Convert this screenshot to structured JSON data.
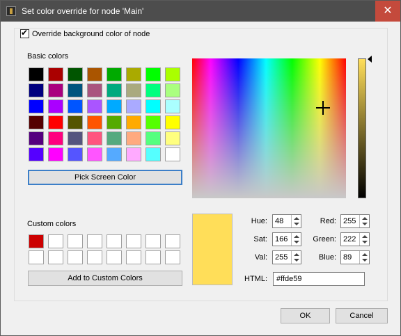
{
  "window": {
    "title": "Set color override for node 'Main'",
    "close_glyph": "✕"
  },
  "override": {
    "label": "Override background color of node",
    "checked": true,
    "check_glyph": "✔"
  },
  "basic_colors": {
    "label": "Basic colors",
    "swatches": [
      "#000000",
      "#aa0000",
      "#005500",
      "#aa5500",
      "#00aa00",
      "#aaaa00",
      "#00ff00",
      "#aaff00",
      "#00007f",
      "#aa007f",
      "#00557f",
      "#aa557f",
      "#00aa7f",
      "#aaaa7f",
      "#00ff7f",
      "#aaff7f",
      "#0000ff",
      "#aa00ff",
      "#0055ff",
      "#aa55ff",
      "#00aaff",
      "#aaaaff",
      "#00ffff",
      "#aaffff",
      "#550000",
      "#ff0000",
      "#555500",
      "#ff5500",
      "#55aa00",
      "#ffaa00",
      "#55ff00",
      "#ffff00",
      "#55007f",
      "#ff007f",
      "#55557f",
      "#ff557f",
      "#55aa7f",
      "#ffaa7f",
      "#55ff7f",
      "#ffff7f",
      "#5500ff",
      "#ff00ff",
      "#5555ff",
      "#ff55ff",
      "#55aaff",
      "#ffaaff",
      "#55ffff",
      "#ffffff"
    ]
  },
  "pick_screen_button": "Pick Screen Color",
  "custom_colors": {
    "label": "Custom colors",
    "swatches": [
      "#cc0000",
      "#ffffff",
      "#ffffff",
      "#ffffff",
      "#ffffff",
      "#ffffff",
      "#ffffff",
      "#ffffff",
      "#ffffff",
      "#ffffff",
      "#ffffff",
      "#ffffff",
      "#ffffff",
      "#ffffff",
      "#ffffff",
      "#ffffff"
    ]
  },
  "add_custom_button": "Add to Custom Colors",
  "current_color": "#ffde59",
  "fields": {
    "hue": {
      "label": "Hue:",
      "value": "48"
    },
    "sat": {
      "label": "Sat:",
      "value": "166"
    },
    "val": {
      "label": "Val:",
      "value": "255"
    },
    "red": {
      "label": "Red:",
      "value": "255"
    },
    "green": {
      "label": "Green:",
      "value": "222"
    },
    "blue": {
      "label": "Blue:",
      "value": "89"
    },
    "html": {
      "label": "HTML:",
      "value": "#ffde59"
    }
  },
  "buttons": {
    "ok": "OK",
    "cancel": "Cancel"
  }
}
